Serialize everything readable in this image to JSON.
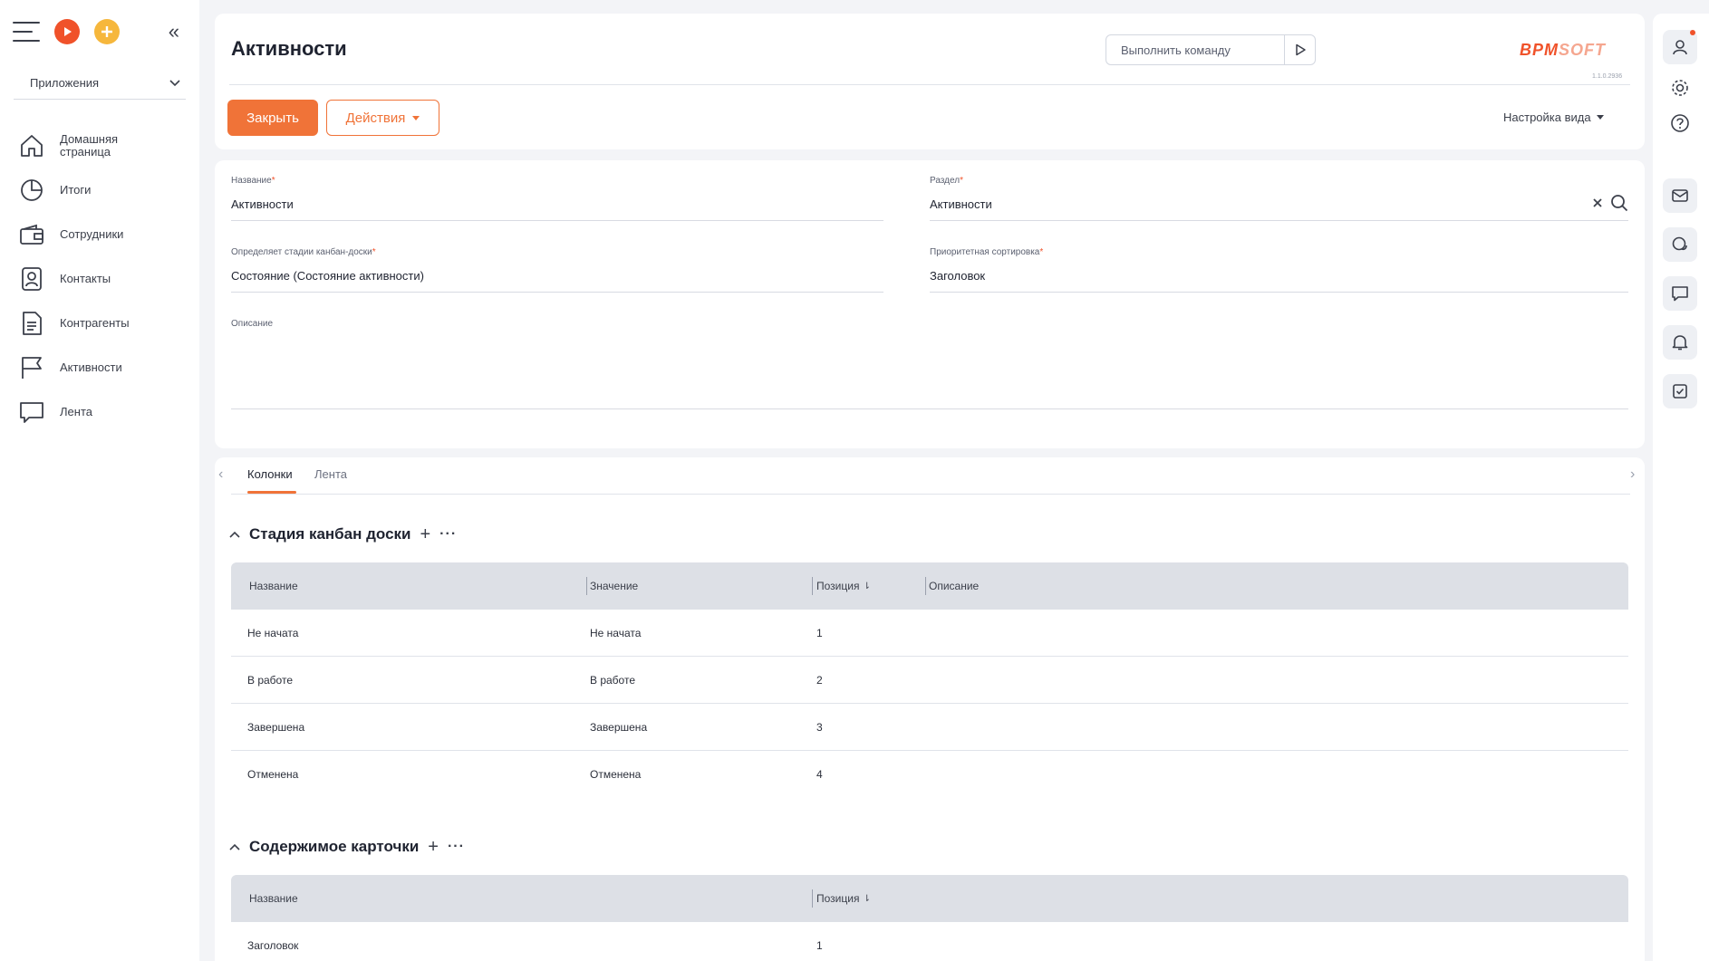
{
  "sidebar": {
    "apps_label": "Приложения",
    "items": [
      {
        "label": "Домашняя страница",
        "icon": "home-icon"
      },
      {
        "label": "Итоги",
        "icon": "pie-chart-icon"
      },
      {
        "label": "Сотрудники",
        "icon": "wallet-icon"
      },
      {
        "label": "Контакты",
        "icon": "contact-card-icon"
      },
      {
        "label": "Контрагенты",
        "icon": "document-icon"
      },
      {
        "label": "Активности",
        "icon": "flag-icon"
      },
      {
        "label": "Лента",
        "icon": "chat-bubble-icon"
      }
    ]
  },
  "header": {
    "title": "Активности",
    "command_placeholder": "Выполнить команду",
    "logo_main": "BPM",
    "logo_soft": "SOFT",
    "version": "1.1.0.2936",
    "close_label": "Закрыть",
    "actions_label": "Действия",
    "view_settings_label": "Настройка вида"
  },
  "form": {
    "name": {
      "label": "Название",
      "value": "Активности"
    },
    "section": {
      "label": "Раздел",
      "value": "Активности"
    },
    "kanban_stage": {
      "label": "Определяет стадии канбан-доски",
      "value": "Состояние (Состояние активности)"
    },
    "priority_sort": {
      "label": "Приоритетная сортировка",
      "value": "Заголовок"
    },
    "description": {
      "label": "Описание",
      "value": ""
    }
  },
  "tabs": [
    {
      "label": "Колонки",
      "active": true
    },
    {
      "label": "Лента",
      "active": false
    }
  ],
  "kanban_group": {
    "title": "Стадия канбан доски",
    "columns": [
      "Название",
      "Значение",
      "Позиция",
      "Описание"
    ],
    "rows": [
      {
        "name": "Не начата",
        "value": "Не начата",
        "position": "1",
        "description": ""
      },
      {
        "name": "В работе",
        "value": "В работе",
        "position": "2",
        "description": ""
      },
      {
        "name": "Завершена",
        "value": "Завершена",
        "position": "3",
        "description": ""
      },
      {
        "name": "Отменена",
        "value": "Отменена",
        "position": "4",
        "description": ""
      }
    ]
  },
  "card_group": {
    "title": "Содержимое карточки",
    "columns": [
      "Название",
      "Позиция"
    ],
    "rows": [
      {
        "name": "Заголовок",
        "position": "1"
      }
    ]
  },
  "colors": {
    "accent": "#f07338",
    "brand_red": "#f0522a",
    "yellow": "#f6b73c",
    "grid_header": "#dde0e6",
    "background": "#f3f4f7"
  }
}
